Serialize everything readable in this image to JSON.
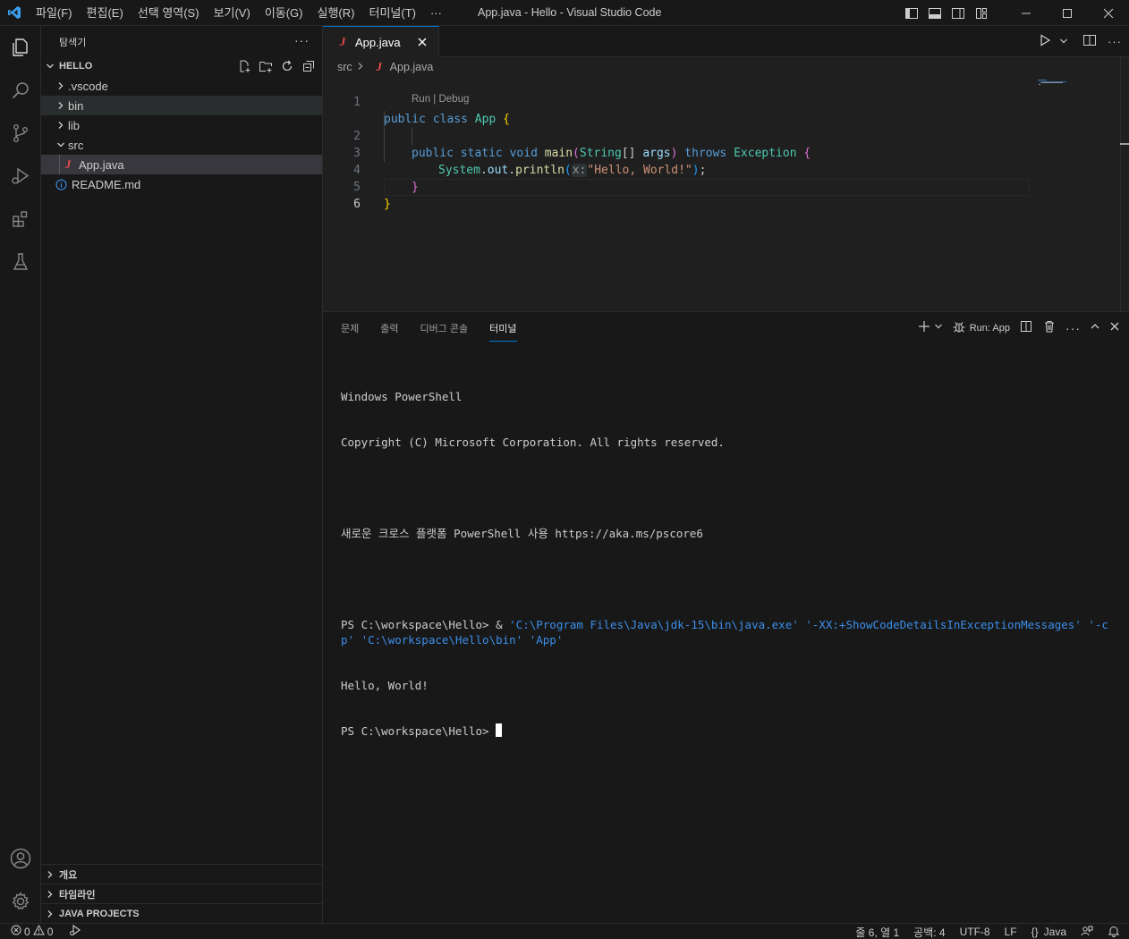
{
  "titlebar": {
    "menu": [
      "파일(F)",
      "편집(E)",
      "선택 영역(S)",
      "보기(V)",
      "이동(G)",
      "실행(R)",
      "터미널(T)",
      "···"
    ],
    "window_title": "App.java - Hello - Visual Studio Code"
  },
  "colors": {
    "accent": "#0078d4",
    "java_icon": "#f14c4c",
    "logo": "#3b9fec"
  },
  "sidebar": {
    "title": "탐색기",
    "more": "···",
    "folder": "HELLO",
    "tree": [
      {
        "label": ".vscode",
        "kind": "folder-collapsed"
      },
      {
        "label": "bin",
        "kind": "folder-collapsed"
      },
      {
        "label": "lib",
        "kind": "folder-collapsed"
      },
      {
        "label": "src",
        "kind": "folder-expanded"
      },
      {
        "label": "App.java",
        "kind": "java-file"
      },
      {
        "label": "README.md",
        "kind": "info-file"
      }
    ],
    "bottom_sections": [
      "개요",
      "타임라인",
      "JAVA PROJECTS"
    ]
  },
  "editor": {
    "tab_label": "App.java",
    "breadcrumb": [
      "src",
      "App.java"
    ],
    "codelens": "Run | Debug",
    "line_numbers": [
      "1",
      "2",
      "3",
      "4",
      "5",
      "6"
    ],
    "code": {
      "l1": [
        "public",
        "class",
        "App",
        "{"
      ],
      "l2": [
        "public",
        "static",
        "void",
        "main",
        "(",
        "String",
        "[]",
        "args",
        ")",
        "throws",
        "Exception",
        "{"
      ],
      "l3": [
        "System",
        ".",
        "out",
        ".",
        "println",
        "(",
        "x:",
        "\"Hello, World!\"",
        ")",
        ";"
      ],
      "l4": "}",
      "l5": "}"
    }
  },
  "panel": {
    "tabs": [
      "문제",
      "출력",
      "디버그 콘솔",
      "터미널"
    ],
    "active_tab": "터미널",
    "run_label": "Run: App",
    "terminal": {
      "line1": "Windows PowerShell",
      "line2": "Copyright (C) Microsoft Corporation. All rights reserved.",
      "line3": "새로운 크로스 플랫폼 PowerShell 사용 https://aka.ms/pscore6",
      "prompt": "PS C:\\workspace\\Hello>",
      "cmd_amp": " & ",
      "cmd_args": "'C:\\Program Files\\Java\\jdk-15\\bin\\java.exe' '-XX:+ShowCodeDetailsInExceptionMessages' '-cp' 'C:\\workspace\\Hello\\bin' 'App'",
      "output": "Hello, World!",
      "prompt2": "PS C:\\workspace\\Hello> "
    }
  },
  "statusbar": {
    "errors": "0",
    "warnings": "0",
    "position": "줄 6, 열 1",
    "spaces": "공백: 4",
    "encoding": "UTF-8",
    "eol": "LF",
    "language_braces": "{}",
    "language": "Java"
  }
}
